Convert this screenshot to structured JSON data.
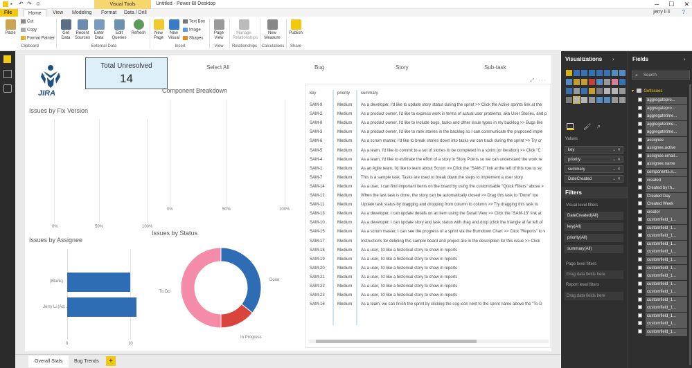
{
  "titlebar": {
    "contextual_tab": "Visual Tools",
    "app_title": "Untitled - Power BI Desktop",
    "minimize": "─",
    "restore": "☐",
    "close": "✕"
  },
  "tabs": [
    "File",
    "Home",
    "View",
    "Modeling",
    "Format",
    "Data / Drill"
  ],
  "user_name": "jerry li li",
  "ribbon": {
    "paste": "Paste",
    "cut": "Cut",
    "copy": "Copy",
    "format_painter": "Format Painter",
    "clipboard": "Clipboard",
    "get_data": "Get Data",
    "recent_sources": "Recent Sources",
    "enter_data": "Enter Data",
    "edit_queries": "Edit Queries",
    "refresh": "Refresh",
    "external_data": "External Data",
    "new_page": "New Page",
    "new_visual": "New Visual",
    "text_box": "Text Box",
    "image": "Image",
    "shapes": "Shapes",
    "insert": "Insert",
    "page_view": "Page View",
    "view": "View",
    "manage_relationships": "Manage Relationships",
    "relationships": "Relationships",
    "new_measure": "New Measure",
    "calculations": "Calculations",
    "publish": "Publish",
    "share": "Share"
  },
  "report": {
    "logo_text": "JIRA",
    "card_title": "Total Unresolved",
    "card_value": "14",
    "slicer": [
      "Select All",
      "Bug",
      "Story",
      "Sub-task"
    ],
    "fix_version": {
      "title": "Issues by Fix Version",
      "ticks": [
        "0%",
        "50%",
        "100%"
      ]
    },
    "component": {
      "title": "Component Breakdown",
      "ticks": [
        "0%",
        "50%",
        "100%"
      ]
    },
    "assignee": {
      "title": "Issues by Assignee",
      "ticks": [
        "0",
        "10"
      ]
    },
    "status": {
      "title": "Issues by Status"
    }
  },
  "chart_data": [
    {
      "type": "bar",
      "orientation": "horizontal",
      "title": "Issues by Assignee",
      "categories": [
        "(Blank)",
        "Jerry Li (Ad..."
      ],
      "values": [
        10,
        11
      ],
      "xlim": [
        0,
        10
      ]
    },
    {
      "type": "pie",
      "variant": "donut",
      "title": "Issues by Status",
      "categories": [
        "Done",
        "In Progress",
        "To Do"
      ],
      "values": [
        5,
        2,
        7
      ],
      "colors": [
        "#2e6db4",
        "#d9453d",
        "#f48ba8"
      ]
    }
  ],
  "table": {
    "headers": [
      "key",
      "priority",
      "summary"
    ],
    "rows": [
      [
        "SAM-9",
        "Medium",
        "As a developer, I'd like to update story status during the sprint >> Click the Active sprints link at the"
      ],
      [
        "SAM-2",
        "Medium",
        "As a product owner, I'd like to express work in terms of actual user problems, aka User Stories, and p"
      ],
      [
        "SAM-8",
        "Medium",
        "As a product owner, I'd like to include bugs, tasks and other issue types in my backlog >> Bugs like"
      ],
      [
        "SAM-3",
        "Medium",
        "As a product owner, I'd like to rank stories in the backlog so I can communicate the proposed imple"
      ],
      [
        "SAM-6",
        "Medium",
        "As a scrum master, I'd like to break stories down into tasks we can track during the sprint >> Try cr"
      ],
      [
        "SAM-5",
        "Medium",
        "As a team, I'd like to commit to a set of stories to be completed in a sprint (or iteration) >> Click \"C"
      ],
      [
        "SAM-4",
        "Medium",
        "As a team, I'd like to estimate the effort of a story in Story Points so we can understand the work re"
      ],
      [
        "SAM-1",
        "Medium",
        "As an Agile team, I'd like to learn about Scrum >> Click the \"SAM-1\" link at the left of this row to se"
      ],
      [
        "SAM-7",
        "Medium",
        "This is a sample task. Tasks are used to break down the steps to implement a user story"
      ],
      [
        "SAM-14",
        "Medium",
        "As a user, I can find important items on the board by using the customisable \"Quick Filters\" above >"
      ],
      [
        "SAM-12",
        "Medium",
        "When the last task is done, the story can be automatically closed >> Drag this task to \"Done\" too"
      ],
      [
        "SAM-11",
        "Medium",
        "Update task status by dragging and dropping from column to column >> Try dragging this task to"
      ],
      [
        "SAM-13",
        "Medium",
        "As a developer, I can update details on an item using the Detail View >> Click the \"SAM-13\" link at"
      ],
      [
        "SAM-10",
        "Medium",
        "As a developer, I can update story and task status with drag and drop (click the triangle at far left of"
      ],
      [
        "SAM-15",
        "Medium",
        "As a scrum master, I can see the progress of a sprint via the Burndown Chart >> Click \"Reports\" to v"
      ],
      [
        "SAM-17",
        "Medium",
        "Instructions for deleting this sample board and project are in the description for this issue >> Click"
      ],
      [
        "SAM-18",
        "Medium",
        "As a user, I'd like a historical story to show in reports"
      ],
      [
        "SAM-19",
        "Medium",
        "As a user, I'd like a historical story to show in reports"
      ],
      [
        "SAM-20",
        "Medium",
        "As a user, I'd like a historical story to show in reports"
      ],
      [
        "SAM-21",
        "Medium",
        "As a user, I'd like a historical story to show in reports"
      ],
      [
        "SAM-22",
        "Medium",
        "As a user, I'd like a historical story to show in reports"
      ],
      [
        "SAM-23",
        "Medium",
        "As a user, I'd like a historical story to show in reports"
      ],
      [
        "SAM-16",
        "Medium",
        "As a team, we can finish the sprint by clicking the cog icon next to the sprint name above the \"To D"
      ]
    ]
  },
  "page_tabs": [
    "Overall Stats",
    "Bug Trends"
  ],
  "add_page": "+",
  "viz_pane": {
    "title": "Visualizations",
    "values_label": "Values",
    "wells": [
      "key",
      "priority",
      "summary",
      "DateCreated"
    ],
    "filters_title": "Filters",
    "visual_level": "Visual level filters",
    "filters": [
      "DateCreated(All)",
      "key(All)",
      "priority(All)",
      "summary(All)"
    ],
    "page_level": "Page level filters",
    "drag_here": "Drag data fields here",
    "report_level": "Report level filters",
    "drag_here2": "Drag data fields here"
  },
  "fields_pane": {
    "title": "Fields",
    "search_placeholder": "Search",
    "table_name": "GetIssues",
    "fields": [
      "aggregatepro...",
      "aggregatepro...",
      "aggregatetime...",
      "aggregatetime...",
      "aggregatetime...",
      "assignee",
      "assignee.active",
      "assignee.email...",
      "assignee.name",
      "components.n...",
      "created",
      "Created by th...",
      "Created Day",
      "Created Week",
      "creator",
      "customfield_1...",
      "customfield_1...",
      "customfield_1...",
      "customfield_1...",
      "customfield_1...",
      "customfield_1...",
      "customfield_1...",
      "customfield_1...",
      "customfield_1...",
      "customfield_1...",
      "customfield_1...",
      "customfield_1...",
      "customfield_1...",
      "customfield_1...",
      "customfield_1..."
    ]
  }
}
